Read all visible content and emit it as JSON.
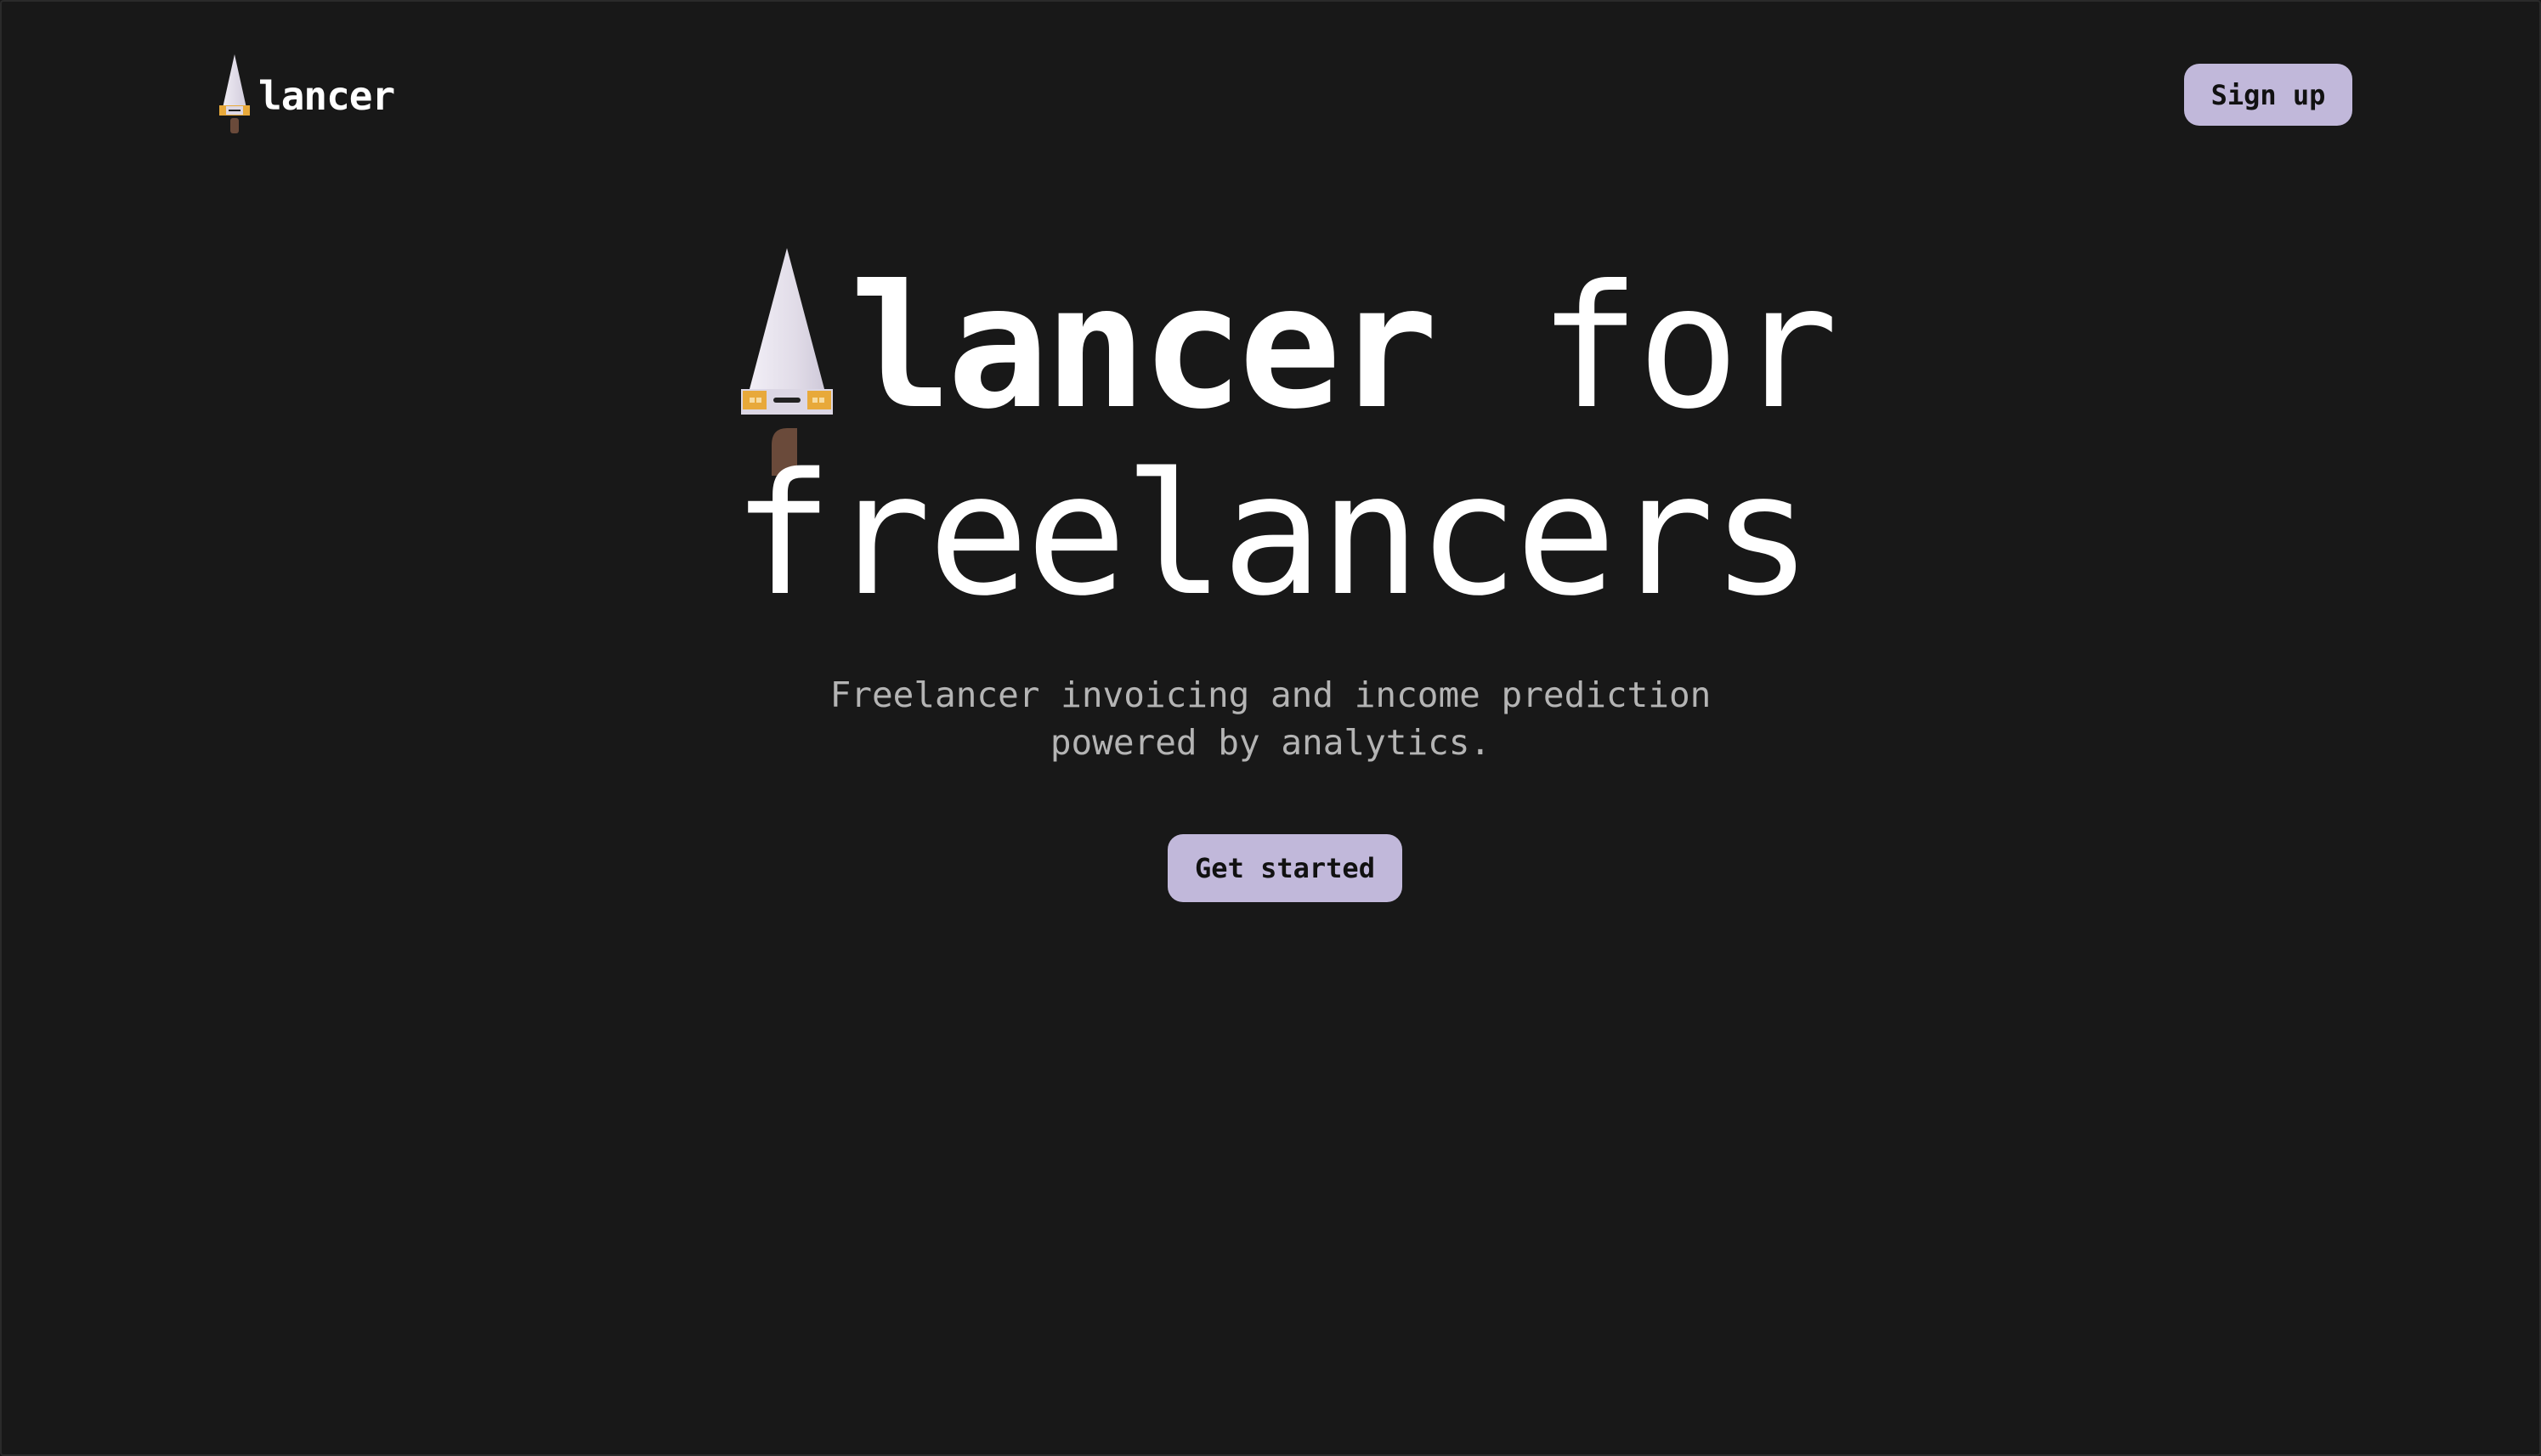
{
  "header": {
    "brand_text": "lancer",
    "signup_label": "Sign up"
  },
  "hero": {
    "title_bold": "lancer",
    "title_normal": "for",
    "title_line2": "freelancers",
    "subtitle_line1": "Freelancer invoicing and income prediction",
    "subtitle_line2": "powered by analytics.",
    "cta_label": "Get started"
  },
  "icons": {
    "brand_logo": "gnome-hat-mascot-icon",
    "hero_logo": "gnome-hat-mascot-icon"
  },
  "colors": {
    "background": "#181818",
    "button_bg": "#c1b8da",
    "button_text": "#111111",
    "heading_text": "#ffffff",
    "subtitle_text": "#b4b4b4",
    "mascot_hat": "#e4e0ea",
    "mascot_band": "#e8a93a",
    "mascot_stem": "#6a4a3a"
  }
}
